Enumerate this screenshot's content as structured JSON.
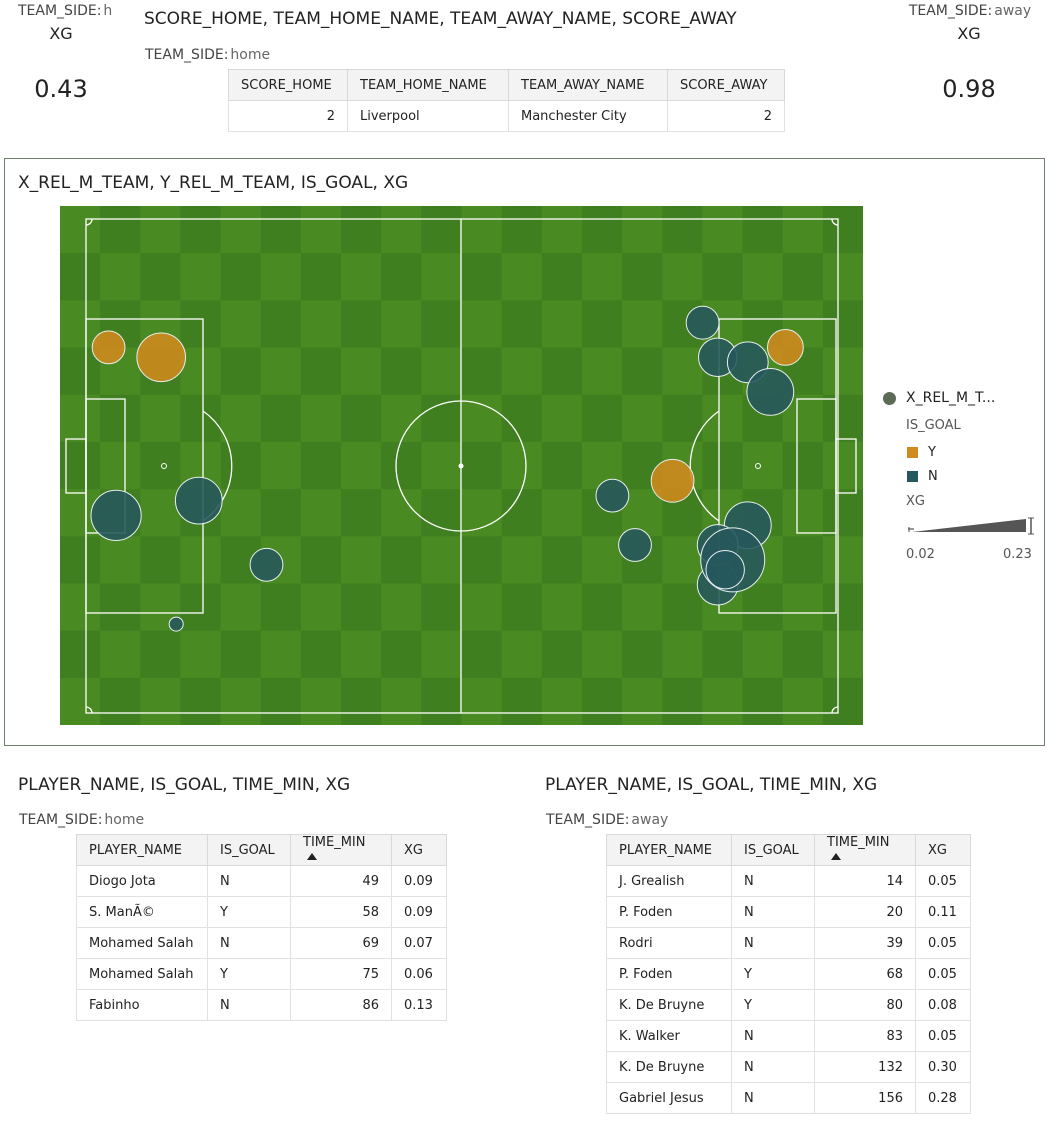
{
  "kpi_home": {
    "side_label": "TEAM_SIDE:",
    "side_value": "h",
    "metric_label": "XG",
    "value": "0.43"
  },
  "kpi_away": {
    "side_label": "TEAM_SIDE:",
    "side_value": "away",
    "metric_label": "XG",
    "value": "0.98"
  },
  "score": {
    "title": "SCORE_HOME, TEAM_HOME_NAME, TEAM_AWAY_NAME, SCORE_AWAY",
    "filter_label": "TEAM_SIDE:",
    "filter_value": "home",
    "headers": [
      "SCORE_HOME",
      "TEAM_HOME_NAME",
      "TEAM_AWAY_NAME",
      "SCORE_AWAY"
    ],
    "row": [
      "2",
      "Liverpool",
      "Manchester City",
      "2"
    ]
  },
  "pitch": {
    "title": "X_REL_M_TEAM, Y_REL_M_TEAM, IS_GOAL, XG",
    "colors": {
      "grass_dark": "#3f7f1f",
      "grass_light": "#4a8a22",
      "line": "#ffffff",
      "goal_Y": "#d08a1e",
      "goal_N": "#25585c"
    }
  },
  "legend": {
    "series_label": "X_REL_M_T...",
    "color_title": "IS_GOAL",
    "items": [
      {
        "label": "Y",
        "color": "#d08a1e"
      },
      {
        "label": "N",
        "color": "#25585c"
      }
    ],
    "size_title": "XG",
    "size_min": "0.02",
    "size_max": "0.23"
  },
  "chart_data": {
    "type": "scatter",
    "title": "X_REL_M_TEAM, Y_REL_M_TEAM, IS_GOAL, XG",
    "series": [
      {
        "name": "Y",
        "points": [
          [
            0.03,
            0.26,
            0.05
          ],
          [
            0.1,
            0.28,
            0.12
          ],
          [
            0.78,
            0.53,
            0.09
          ],
          [
            0.93,
            0.26,
            0.06
          ]
        ]
      },
      {
        "name": "N",
        "points": [
          [
            0.04,
            0.6,
            0.13
          ],
          [
            0.15,
            0.57,
            0.11
          ],
          [
            0.24,
            0.7,
            0.05
          ],
          [
            0.12,
            0.82,
            0.02
          ],
          [
            0.7,
            0.56,
            0.05
          ],
          [
            0.73,
            0.66,
            0.05
          ],
          [
            0.82,
            0.21,
            0.05
          ],
          [
            0.84,
            0.28,
            0.07
          ],
          [
            0.88,
            0.29,
            0.08
          ],
          [
            0.91,
            0.35,
            0.11
          ],
          [
            0.88,
            0.62,
            0.11
          ],
          [
            0.84,
            0.66,
            0.08
          ],
          [
            0.84,
            0.74,
            0.08
          ],
          [
            0.86,
            0.69,
            0.23
          ],
          [
            0.85,
            0.71,
            0.07
          ]
        ]
      }
    ]
  },
  "table_home": {
    "title": "PLAYER_NAME, IS_GOAL, TIME_MIN, XG",
    "filter_label": "TEAM_SIDE:",
    "filter_value": "home",
    "headers": [
      "PLAYER_NAME",
      "IS_GOAL",
      "TIME_MIN",
      "XG"
    ],
    "rows": [
      [
        "Diogo Jota",
        "N",
        "49",
        "0.09"
      ],
      [
        "S. ManÃ©",
        "Y",
        "58",
        "0.09"
      ],
      [
        "Mohamed Salah",
        "N",
        "69",
        "0.07"
      ],
      [
        "Mohamed Salah",
        "Y",
        "75",
        "0.06"
      ],
      [
        "Fabinho",
        "N",
        "86",
        "0.13"
      ]
    ]
  },
  "table_away": {
    "title": "PLAYER_NAME, IS_GOAL, TIME_MIN, XG",
    "filter_label": "TEAM_SIDE:",
    "filter_value": "away",
    "headers": [
      "PLAYER_NAME",
      "IS_GOAL",
      "TIME_MIN",
      "XG"
    ],
    "rows": [
      [
        "J. Grealish",
        "N",
        "14",
        "0.05"
      ],
      [
        "P. Foden",
        "N",
        "20",
        "0.11"
      ],
      [
        "Rodri",
        "N",
        "39",
        "0.05"
      ],
      [
        "P. Foden",
        "Y",
        "68",
        "0.05"
      ],
      [
        "K. De Bruyne",
        "Y",
        "80",
        "0.08"
      ],
      [
        "K. Walker",
        "N",
        "83",
        "0.05"
      ],
      [
        "K. De Bruyne",
        "N",
        "132",
        "0.30"
      ],
      [
        "Gabriel Jesus",
        "N",
        "156",
        "0.28"
      ]
    ]
  }
}
